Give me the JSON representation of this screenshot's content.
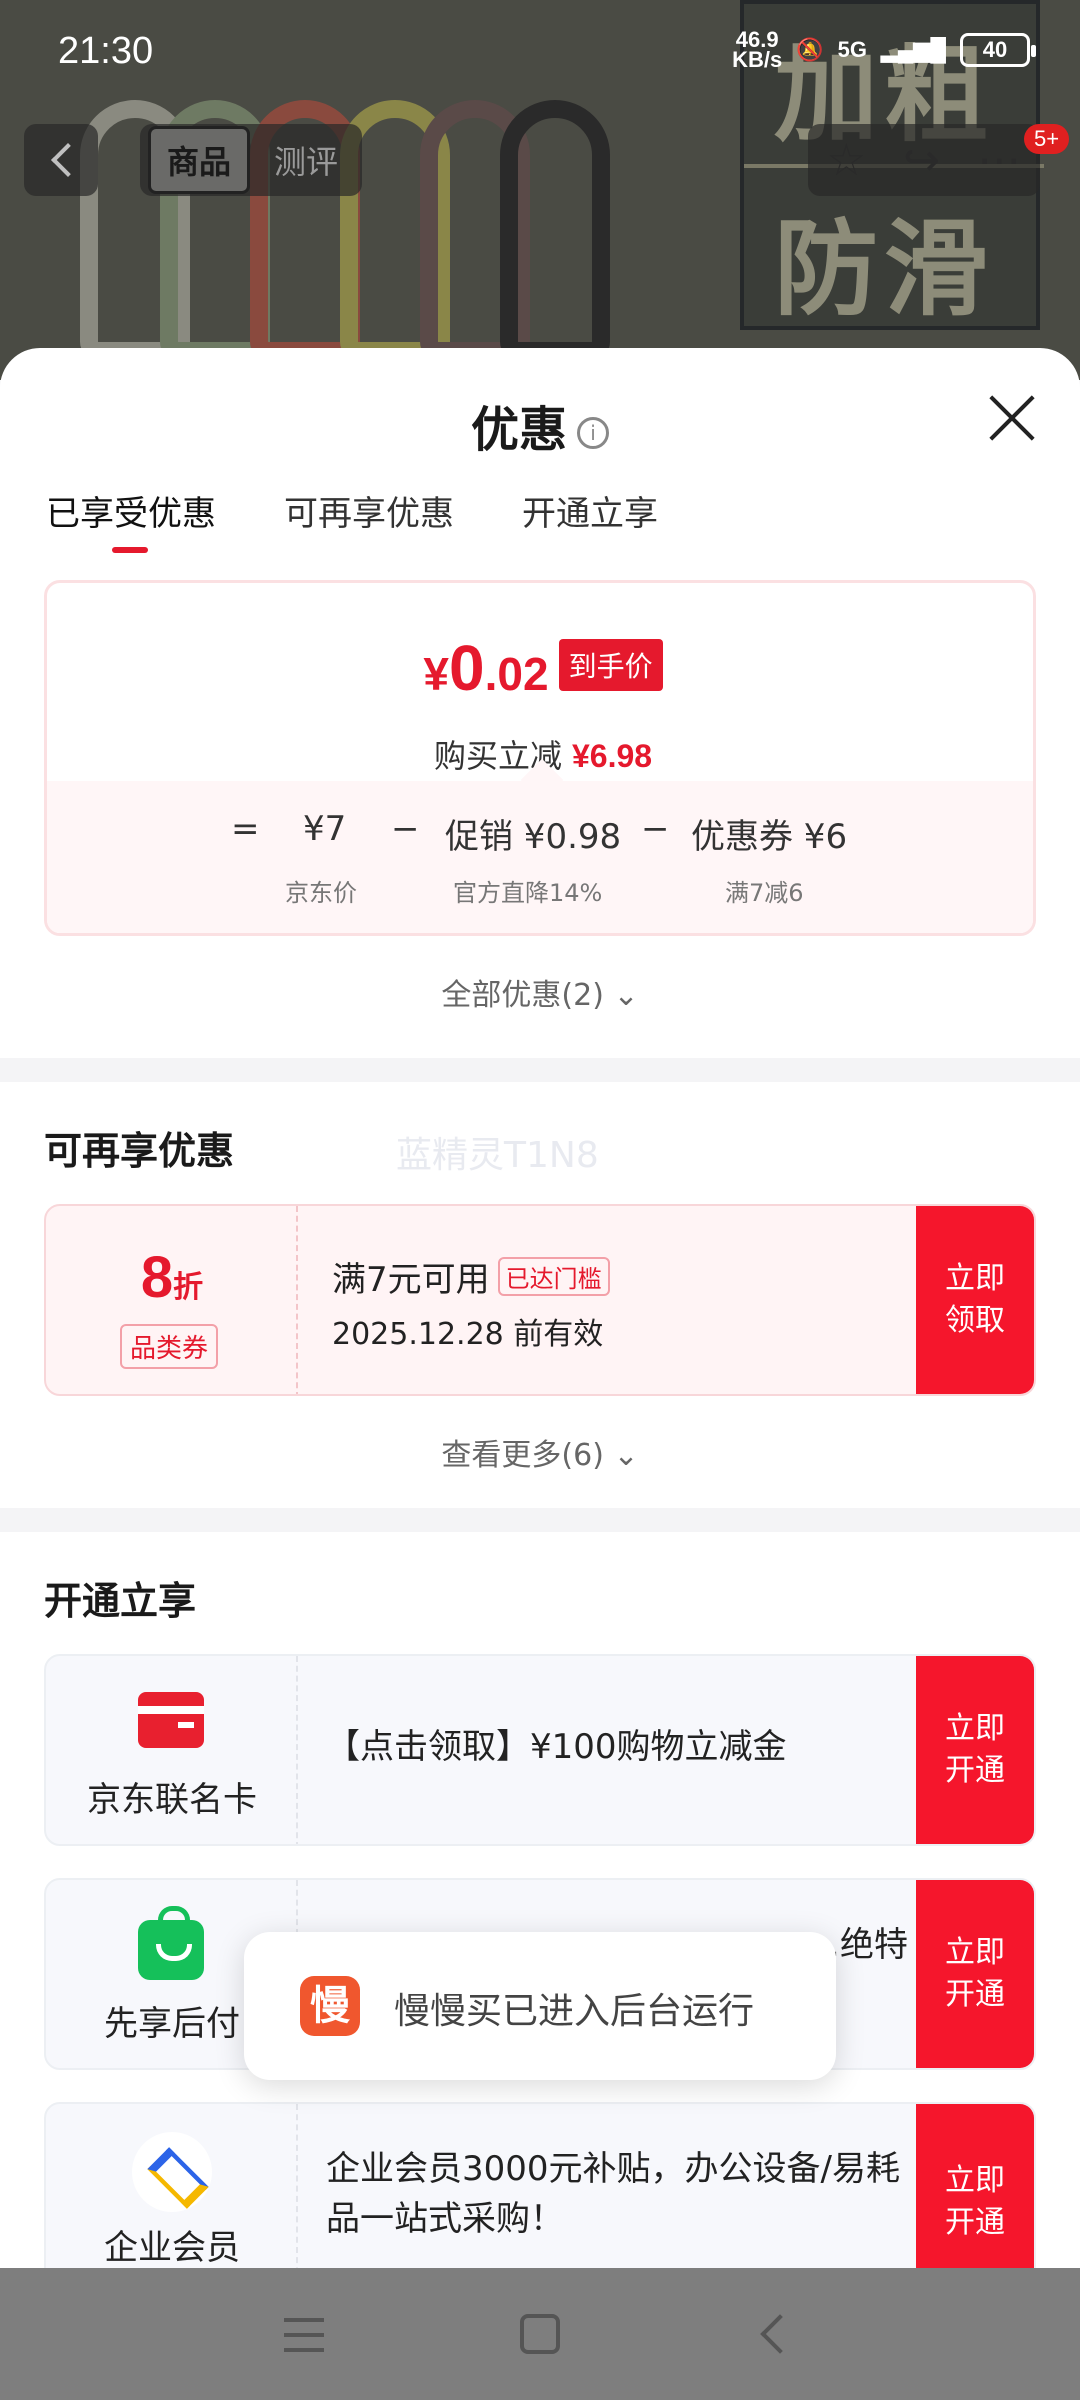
{
  "status_bar": {
    "time": "21:30",
    "net_speed_value": "46.9",
    "net_speed_unit": "KB/s",
    "network": "5G",
    "battery": "40"
  },
  "product_banner": {
    "line1": "加粗",
    "line2": "防滑"
  },
  "top_nav": {
    "tabs": [
      {
        "label": "商品",
        "active": true
      },
      {
        "label": "测评",
        "active": false
      }
    ],
    "badge": "5+",
    "icons": [
      "star-icon",
      "share-icon",
      "more-icon"
    ]
  },
  "sheet": {
    "title": "优惠",
    "tabs": [
      {
        "label": "已享受优惠",
        "active": true
      },
      {
        "label": "可再享优惠",
        "active": false
      },
      {
        "label": "开通立享",
        "active": false
      }
    ],
    "price_card": {
      "currency": "¥",
      "price_int": "0",
      "price_dec": ".02",
      "price_tag": "到手价",
      "instant_label": "购买立减",
      "instant_amount": "¥6.98",
      "equals": "=",
      "base_price": "¥7",
      "base_label": "京东价",
      "minus1": "−",
      "promo": "促销 ¥0.98",
      "promo_label": "官方直降14%",
      "minus2": "−",
      "coupon": "优惠券 ¥6",
      "coupon_label": "满7减6"
    },
    "all_discounts": "全部优惠(2)",
    "more_section": {
      "title": "可再享优惠",
      "watermark": "蓝精灵T1N8",
      "coupon": {
        "discount": "8",
        "discount_unit": "折",
        "kind": "品类券",
        "condition": "满7元可用",
        "reached": "已达门槛",
        "expiry": "2025.12.28 前有效",
        "button_line1": "立即",
        "button_line2": "领取"
      },
      "view_more": "查看更多(6)"
    },
    "open_section": {
      "title": "开通立享",
      "items": [
        {
          "name": "京东联名卡",
          "text": "【点击领取】¥100购物立减金",
          "button_line1": "立即",
          "button_line2": "开通"
        },
        {
          "name": "先享后付",
          "text": "…绝特",
          "button_line1": "立即",
          "button_line2": "开通"
        },
        {
          "name": "企业会员",
          "text": "企业会员3000元补贴，办公设备/易耗品一站式采购！",
          "button_line1": "立即",
          "button_line2": "开通"
        }
      ]
    }
  },
  "toast": {
    "icon_char": "慢",
    "text": "慢慢买已进入后台运行"
  },
  "colors": {
    "accent_red": "#e5192d",
    "button_red": "#f5162c",
    "green": "#15c05a",
    "toast_orange": "#f0572e"
  }
}
